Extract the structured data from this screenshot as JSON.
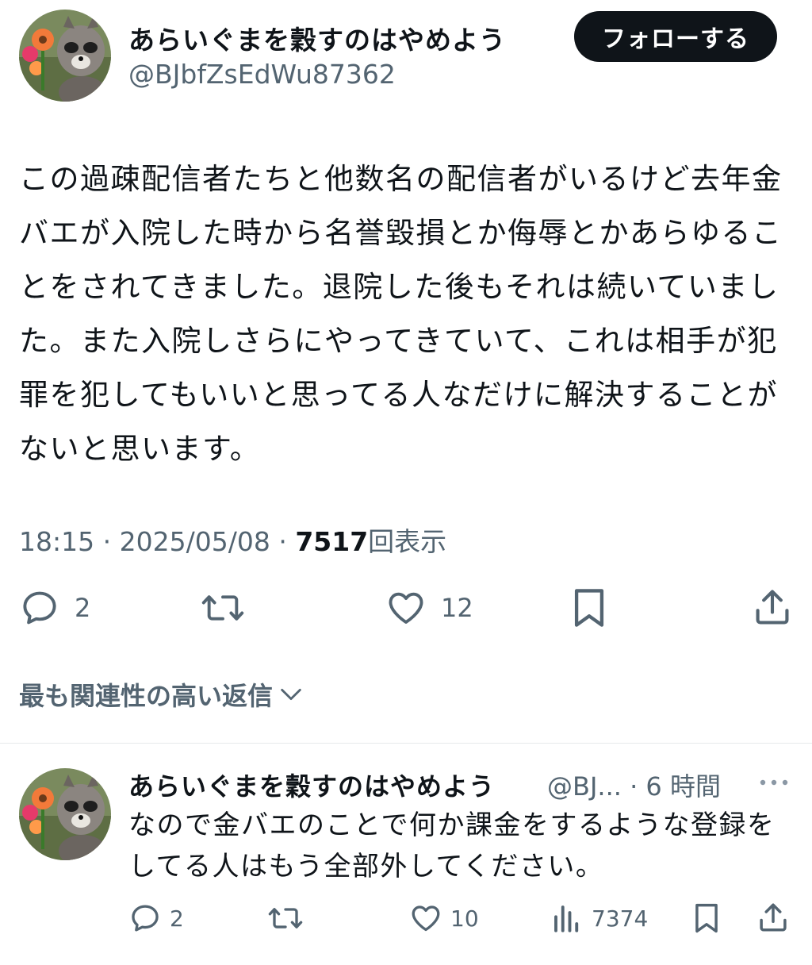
{
  "tweet": {
    "display_name": "あらいぐまを穀すのはやめよう",
    "handle": "@BJbfZsEdWu87362",
    "follow_label": "フォローする",
    "body": "この過疎配信者たちと他数名の配信者がいるけど去年金バエが入院した時から名誉毀損とか侮辱とかあらゆることをされてきました。退院した後もそれは続いていました。また入院しさらにやってきていて、これは相手が犯罪を犯してもいいと思ってる人なだけに解決することがないと思います。",
    "time": "18:15",
    "date": "2025/05/08",
    "views": "7517",
    "views_label": "回表示",
    "separator": "·",
    "actions": {
      "reply_count": "2",
      "like_count": "12"
    },
    "icons": [
      "reply-icon",
      "retweet-icon",
      "like-icon",
      "bookmark-icon",
      "share-icon"
    ]
  },
  "replies_sort_label": "最も関連性の高い返信",
  "reply": {
    "display_name": "あらいぐまを穀すのはやめよう",
    "handle_truncated": "@BJ...",
    "separator": "·",
    "time_ago": "6 時間",
    "body": "なので金バエのことで何か課金をするような登録をしてる人はもう全部外してください。",
    "reply_count": "2",
    "like_count": "10",
    "views_count": "7374"
  },
  "colors": {
    "text": "#0f1419",
    "secondary": "#536471",
    "follow_bg": "#0f1419",
    "divider": "#e6e9eb"
  }
}
